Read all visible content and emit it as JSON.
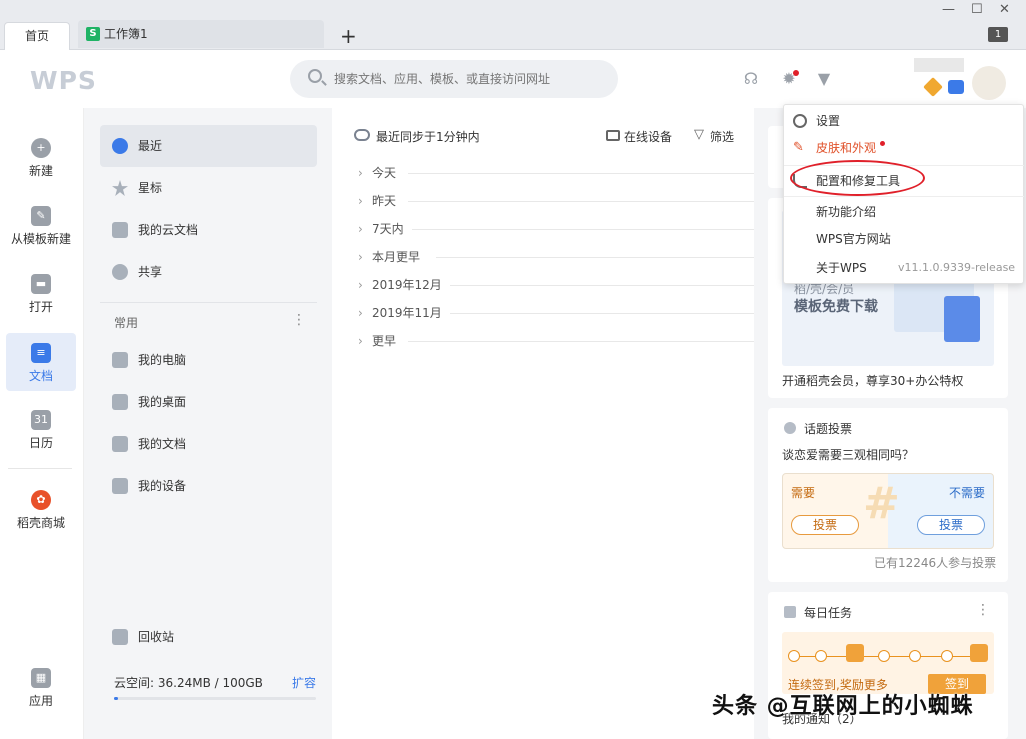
{
  "tabs": {
    "home": "首页",
    "doc": "工作簿1",
    "doc_icon": "S",
    "add": "+"
  },
  "window": {
    "tab_count": "1"
  },
  "header": {
    "logo": "WPS",
    "search_placeholder": "搜索文档、应用、模板、或直接访问网址"
  },
  "leftnav": [
    {
      "label": "新建",
      "icon": "+"
    },
    {
      "label": "从模板新建",
      "icon": "✎"
    },
    {
      "label": "打开",
      "icon": "▬"
    },
    {
      "label": "文档",
      "icon": "≡"
    },
    {
      "label": "日历",
      "icon": "31"
    },
    {
      "label": "稻壳商城",
      "icon": "✿"
    },
    {
      "label": "应用",
      "icon": "▦"
    }
  ],
  "col2": {
    "items": [
      "最近",
      "星标",
      "我的云文档",
      "共享"
    ],
    "section_common": "常用",
    "common_items": [
      "我的电脑",
      "我的桌面",
      "我的文档",
      "我的设备"
    ],
    "recycle": "回收站",
    "storage": "云空间: 36.24MB / 100GB",
    "expand": "扩容"
  },
  "col3": {
    "sync": "最近同步于1分钟内",
    "online_devices": "在线设备",
    "filter": "筛选",
    "groups": [
      "今天",
      "昨天",
      "7天内",
      "本月更早",
      "2019年12月",
      "2019年11月",
      "更早"
    ]
  },
  "menu": {
    "settings": "设置",
    "skin": "皮肤和外观",
    "repair": "配置和修复工具",
    "new_features": "新功能介绍",
    "website": "WPS官方网站",
    "about": "关于WPS",
    "version": "v11.1.0.9339-release"
  },
  "right": {
    "banner_small": "稻/壳/会/员",
    "banner_big": "模板免费下载",
    "member_text": "开通稻壳会员，尊享30+办公特权",
    "vote_title": "话题投票",
    "vote_question": "谈恋爱需要三观相同吗？",
    "vote_yes": "需要",
    "vote_no": "不需要",
    "vote_btn": "投票",
    "vote_count": "已有12246人参与投票",
    "task_title": "每日任务",
    "task_text": "连续签到,奖励更多",
    "sign_btn": "签到",
    "notice": "我的通知（2）"
  },
  "watermark": "头条 @互联网上的小蜘蛛",
  "colors": {
    "accent": "#3b7ae8",
    "skin": "#e0512a",
    "ring": "#e0202a",
    "sheet": "#1fb365"
  }
}
